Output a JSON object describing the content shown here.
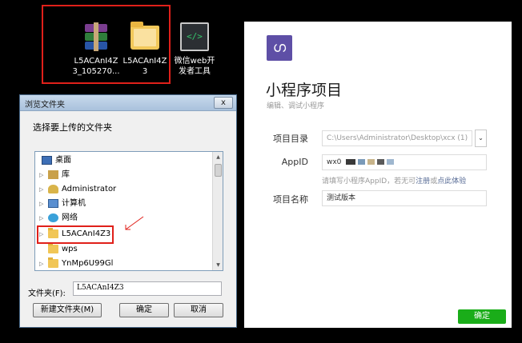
{
  "desktop": {
    "icons": [
      {
        "label_line1": "L5ACAnI4Z",
        "label_line2": "3_105270...",
        "icon": "winrar-archive-icon"
      },
      {
        "label_line1": "L5ACAnI4Z",
        "label_line2": "3",
        "icon": "folder-icon"
      },
      {
        "label_line1": "微信web开",
        "label_line2": "发者工具",
        "icon": "wechat-devtools-icon"
      }
    ]
  },
  "dialog": {
    "title": "浏览文件夹",
    "close_label": "x",
    "prompt": "选择要上传的文件夹",
    "tree": [
      {
        "label": "桌面",
        "icon": "desktop-icon",
        "arrow": ""
      },
      {
        "label": "库",
        "icon": "library-icon",
        "arrow": "▷"
      },
      {
        "label": "Administrator",
        "icon": "user-folder-icon",
        "arrow": "▷"
      },
      {
        "label": "计算机",
        "icon": "computer-icon",
        "arrow": "▷"
      },
      {
        "label": "网络",
        "icon": "network-icon",
        "arrow": "▷"
      },
      {
        "label": "L5ACAnI4Z3",
        "icon": "folder-icon",
        "arrow": "▷"
      },
      {
        "label": "wps",
        "icon": "folder-icon",
        "arrow": ""
      },
      {
        "label": "YnMp6U99Gl",
        "icon": "folder-icon",
        "arrow": "▷"
      }
    ],
    "folder_label": "文件夹(F):",
    "folder_value": "L5ACAnI4Z3",
    "new_folder_button": "新建文件夹(M)",
    "ok_button": "确定",
    "cancel_button": "取消"
  },
  "panel": {
    "logo_glyph": "ഗ",
    "title": "小程序项目",
    "subtitle": "编辑、调试小程序",
    "project_dir_label": "项目目录",
    "project_dir_value": "C:\\Users\\Administrator\\Desktop\\xcx (1)",
    "dropdown_glyph": "⌄",
    "appid_label": "AppID",
    "appid_value": "wx0",
    "hint_prefix": "请填写小程序AppID，若无可",
    "hint_link1": "注册",
    "hint_mid": "或",
    "hint_link2": "点此体验",
    "project_name_label": "项目名称",
    "project_name_value": "测试版本",
    "confirm_button": "确定"
  },
  "colors": {
    "highlight_red": "#e0201a",
    "accent_purple": "#5e4fa6",
    "confirm_green": "#1aad19",
    "link_blue": "#576b95"
  }
}
